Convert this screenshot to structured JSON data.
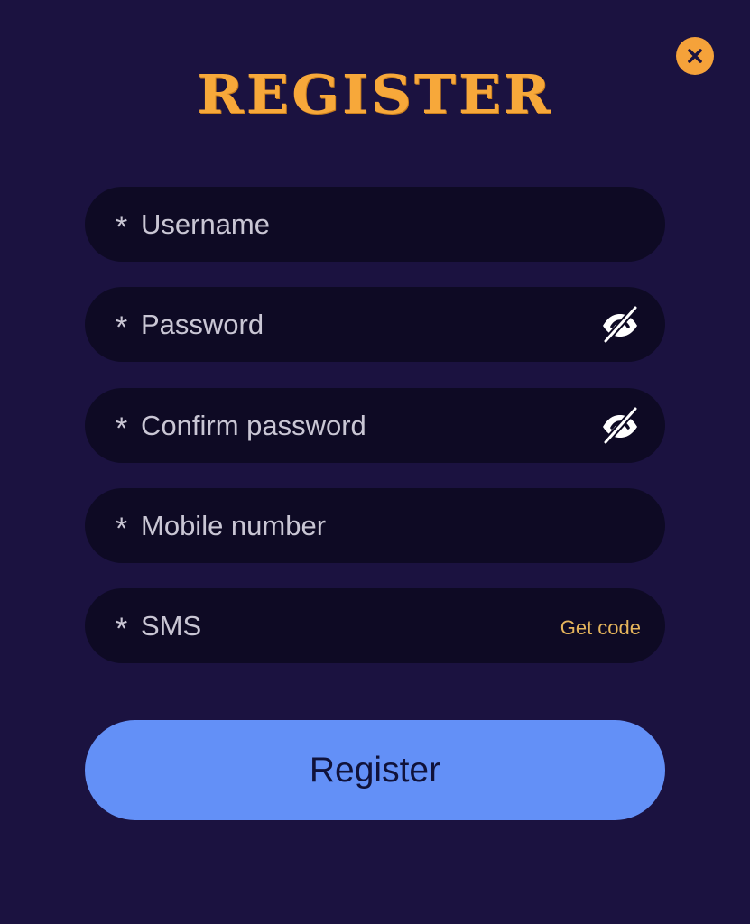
{
  "dialog": {
    "title": "REGISTER",
    "close_icon": "close-icon"
  },
  "form": {
    "required_marker": "*",
    "username": {
      "placeholder": "Username",
      "value": ""
    },
    "password": {
      "placeholder": "Password",
      "value": "",
      "toggle_icon": "eye-off-icon"
    },
    "confirm_password": {
      "placeholder": "Confirm password",
      "value": "",
      "toggle_icon": "eye-off-icon"
    },
    "mobile": {
      "placeholder": "Mobile number",
      "value": ""
    },
    "sms": {
      "placeholder": "SMS",
      "value": "",
      "get_code_label": "Get code"
    },
    "submit_label": "Register"
  },
  "colors": {
    "background": "#1b1240",
    "field_background": "#0e0a24",
    "accent": "#f7a83a",
    "button": "#6390f7",
    "get_code": "#e6b55c"
  }
}
